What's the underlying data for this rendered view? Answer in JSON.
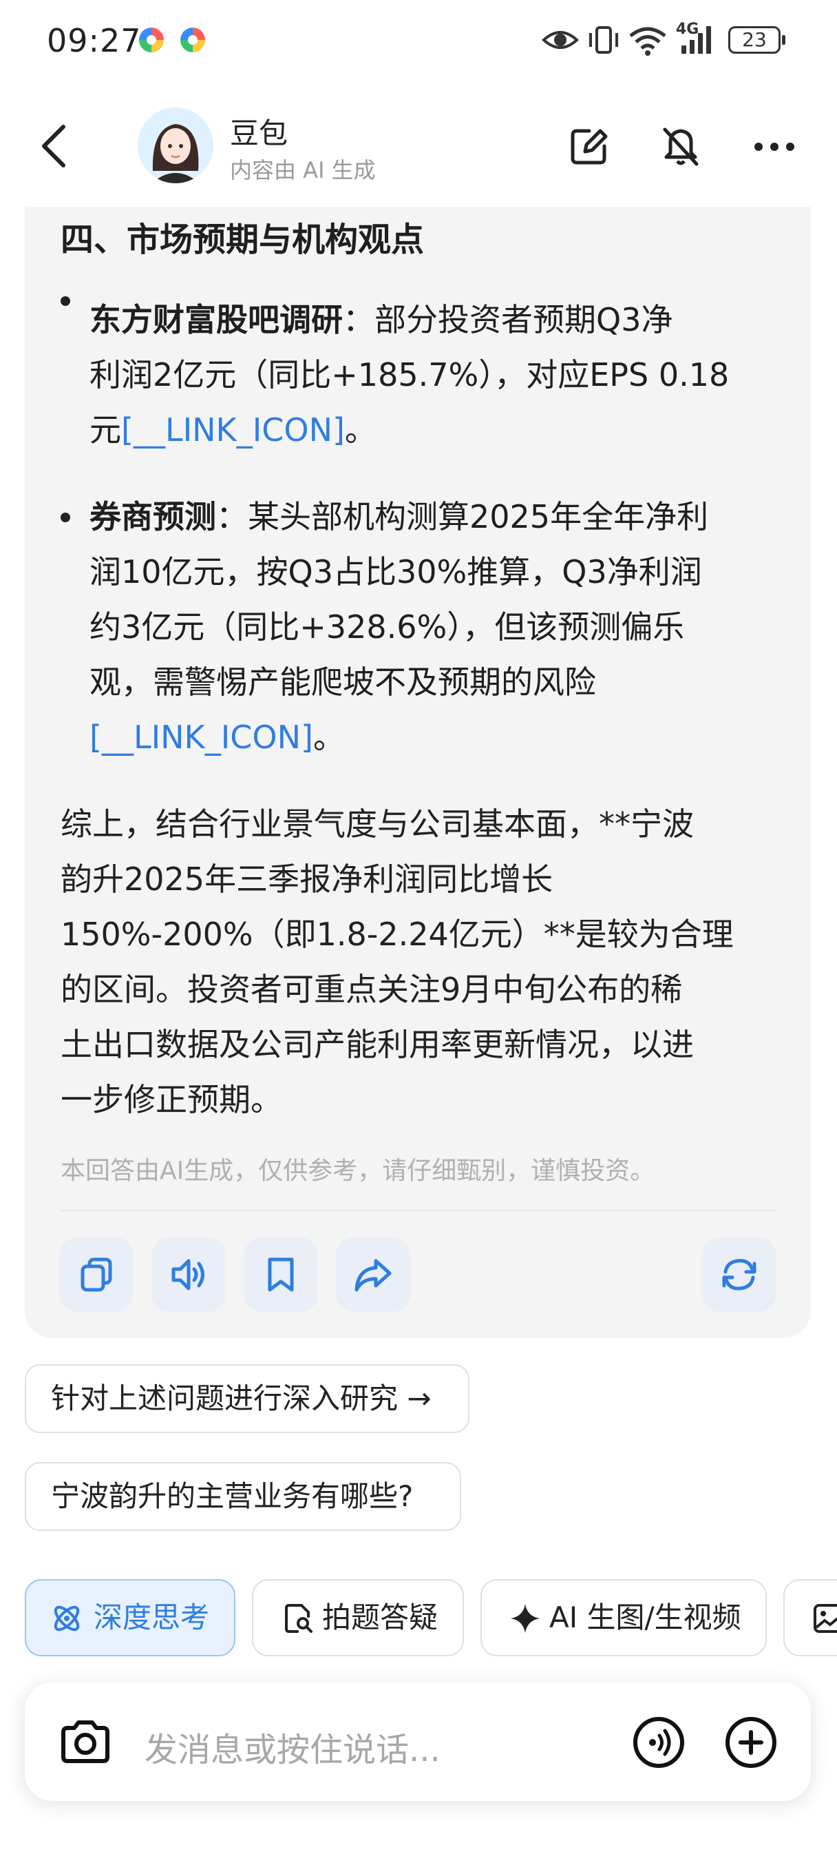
{
  "status_bar": {
    "time": "09:27",
    "network": "4G",
    "battery": "23",
    "icons": [
      "color-app-icon",
      "color-app-icon",
      "eye-icon",
      "vibrate-icon",
      "wifi-icon",
      "signal-icon"
    ]
  },
  "header": {
    "name": "豆包",
    "subtitle": "内容由 AI 生成",
    "icons": [
      "back-icon",
      "edit-icon",
      "mute-icon",
      "more-icon"
    ]
  },
  "message": {
    "section_title": "四、市场预期与机构观点",
    "bullets": [
      {
        "label": "东方财富股吧调研",
        "line1": "：部分投资者预期Q3净",
        "line2": "利润2亿元（同比+185.7%），对应EPS 0.18",
        "line3_pre": "元",
        "link": "[__LINK_ICON]",
        "line3_post": "。"
      },
      {
        "label": "券商预测",
        "line1": "：某头部机构测算2025年全年净利",
        "line2": "润10亿元，按Q3占比30%推算，Q3净利润",
        "line3": "约3亿元（同比+328.6%），但该预测偏乐",
        "line4": "观，需警惕产能爬坡不及预期的风险",
        "link": "[__LINK_ICON]",
        "line5_post": "。"
      }
    ],
    "summary_lines": [
      "综上，结合行业景气度与公司基本面，**宁波",
      "韵升2025年三季报净利润同比增长",
      "150%-200%（即1.8-2.24亿元）**是较为合理",
      "的区间。投资者可重点关注9月中旬公布的稀",
      "土出口数据及公司产能利用率更新情况，以进",
      "一步修正预期。"
    ],
    "disclaimer": "本回答由AI生成，仅供参考，请仔细甄别，谨慎投资。",
    "actions": [
      "copy-icon",
      "speaker-icon",
      "bookmark-icon",
      "share-icon",
      "regenerate-icon"
    ]
  },
  "suggestions": [
    {
      "label": "针对上述问题进行深入研究 →"
    },
    {
      "label": "宁波韵升的主营业务有哪些?"
    }
  ],
  "tools": [
    {
      "label": "深度思考",
      "icon": "atom-icon",
      "active": true
    },
    {
      "label": "拍题答疑",
      "icon": "photo-search-icon",
      "active": false
    },
    {
      "label": "AI 生图/生视频",
      "icon": "sparkle-icon",
      "active": false
    },
    {
      "label": "",
      "icon": "image-icon",
      "active": false
    }
  ],
  "input": {
    "placeholder": "发消息或按住说话..."
  },
  "colors": {
    "accent": "#2f7de1",
    "card_bg": "#f4f4f4",
    "action_bg": "#e9eef7"
  }
}
